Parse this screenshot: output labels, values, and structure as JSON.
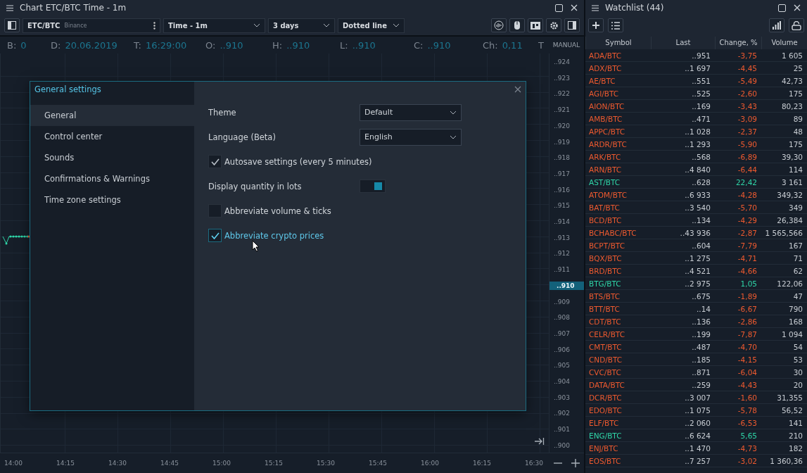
{
  "chart_panel": {
    "title": "Chart ETC/BTC Time - 1m",
    "toolbar": {
      "symbol": "ETC/BTC",
      "exchange": "Binance",
      "timeframe": "Time - 1m",
      "range": "3 days",
      "style": "Dotted line"
    },
    "info": [
      {
        "label": "B:",
        "value": "0"
      },
      {
        "label": "D:",
        "value": "20.06.2019"
      },
      {
        "label": "T:",
        "value": "16:29:00"
      },
      {
        "label": "O:",
        "value": "..910"
      },
      {
        "label": "H:",
        "value": "..910"
      },
      {
        "label": "L:",
        "value": "..910"
      },
      {
        "label": "C:",
        "value": "..910"
      },
      {
        "label": "Ch:",
        "value": "0,11"
      },
      {
        "label": "T"
      }
    ],
    "scale_mode": "MANUAL",
    "price_axis": [
      "..924",
      "..923",
      "..922",
      "..921",
      "..920",
      "..919",
      "..918",
      "..917",
      "..916",
      "..915",
      "..914",
      "..913",
      "..912",
      "..911",
      {
        "kind": "current",
        "label": "..910"
      },
      "..909",
      "..908",
      "..907",
      "..906",
      "..905",
      "..904",
      "..903",
      "..902",
      "..901",
      "..900"
    ],
    "time_axis": [
      "14:00",
      "14:15",
      "14:30",
      "14:45",
      "15:00",
      "15:15",
      "15:30",
      "15:45",
      "16:00",
      "16:15",
      "16:30"
    ]
  },
  "dialog": {
    "title": "General settings",
    "nav": [
      {
        "label": "General",
        "selected": true
      },
      {
        "label": "Control center",
        "selected": false
      },
      {
        "label": "Sounds",
        "selected": false
      },
      {
        "label": "Confirmations & Warnings",
        "selected": false
      },
      {
        "label": "Time zone settings",
        "selected": false
      }
    ],
    "settings": [
      {
        "kind": "select",
        "label": "Theme",
        "value": "Default"
      },
      {
        "kind": "select",
        "label": "Language (Beta)",
        "value": "English"
      },
      {
        "kind": "checkbox",
        "label": "Autosave settings (every 5 minutes)",
        "checked": true,
        "hovered": false
      },
      {
        "kind": "toggle",
        "label": "Display quantity in lots",
        "on": true
      },
      {
        "kind": "checkbox",
        "label": "Abbreviate volume & ticks",
        "checked": false,
        "hovered": false
      },
      {
        "kind": "checkbox",
        "label": "Abbreviate crypto prices",
        "checked": true,
        "hovered": true
      }
    ]
  },
  "watchlist": {
    "title": "Watchlist (44)",
    "columns": [
      "Symbol",
      "Last",
      "Change, %",
      "Volume"
    ],
    "rows": [
      {
        "symbol": "ADA/BTC",
        "last": "..951",
        "change": "-3,75",
        "volume": "1 605",
        "color": "#ef5a2f"
      },
      {
        "symbol": "ADX/BTC",
        "last": "..1 697",
        "change": "-4,45",
        "volume": "25",
        "color": "#ef5a2f"
      },
      {
        "symbol": "AE/BTC",
        "last": "..551",
        "change": "-5,49",
        "volume": "42,73",
        "color": "#ef5a2f"
      },
      {
        "symbol": "AGI/BTC",
        "last": "..525",
        "change": "-2,60",
        "volume": "175",
        "color": "#ef5a2f"
      },
      {
        "symbol": "AION/BTC",
        "last": "..169",
        "change": "-3,43",
        "volume": "80,23",
        "color": "#ef5a2f"
      },
      {
        "symbol": "AMB/BTC",
        "last": "..471",
        "change": "-3,09",
        "volume": "89",
        "color": "#ef5a2f"
      },
      {
        "symbol": "APPC/BTC",
        "last": "..1 028",
        "change": "-2,37",
        "volume": "48",
        "color": "#ef5a2f"
      },
      {
        "symbol": "ARDR/BTC",
        "last": "..1 293",
        "change": "-5,90",
        "volume": "175",
        "color": "#ef5a2f"
      },
      {
        "symbol": "ARK/BTC",
        "last": "..568",
        "change": "-6,89",
        "volume": "39,30",
        "color": "#ef5a2f"
      },
      {
        "symbol": "ARN/BTC",
        "last": "..4 840",
        "change": "-6,44",
        "volume": "114",
        "color": "#ef5a2f"
      },
      {
        "symbol": "AST/BTC",
        "last": "..628",
        "change": "22,42",
        "volume": "3 161",
        "color": "#2fd6a8"
      },
      {
        "symbol": "ATOM/BTC",
        "last": "..6 933",
        "change": "-4,28",
        "volume": "349,32",
        "color": "#ef5a2f"
      },
      {
        "symbol": "BAT/BTC",
        "last": "..3 540",
        "change": "-5,70",
        "volume": "349",
        "color": "#ef5a2f"
      },
      {
        "symbol": "BCD/BTC",
        "last": "..134",
        "change": "-4,29",
        "volume": "26,384",
        "color": "#ef5a2f"
      },
      {
        "symbol": "BCHABC/BTC",
        "last": "..43 936",
        "change": "-2,87",
        "volume": "1 565,566",
        "color": "#ef5a2f"
      },
      {
        "symbol": "BCPT/BTC",
        "last": "..604",
        "change": "-7,79",
        "volume": "167",
        "color": "#ef5a2f"
      },
      {
        "symbol": "BQX/BTC",
        "last": "..1 275",
        "change": "-4,71",
        "volume": "71",
        "color": "#ef5a2f"
      },
      {
        "symbol": "BRD/BTC",
        "last": "..4 521",
        "change": "-4,66",
        "volume": "62",
        "color": "#ef5a2f"
      },
      {
        "symbol": "BTG/BTC",
        "last": "..2 975",
        "change": "1,05",
        "volume": "122,06",
        "color": "#2fd6a8"
      },
      {
        "symbol": "BTS/BTC",
        "last": "..675",
        "change": "-1,89",
        "volume": "47",
        "color": "#ef5a2f"
      },
      {
        "symbol": "BTT/BTC",
        "last": "..14",
        "change": "-6,67",
        "volume": "790",
        "color": "#ef5a2f"
      },
      {
        "symbol": "CDT/BTC",
        "last": "..136",
        "change": "-2,86",
        "volume": "168",
        "color": "#ef5a2f"
      },
      {
        "symbol": "CELR/BTC",
        "last": "..199",
        "change": "-7,87",
        "volume": "1 094",
        "color": "#ef5a2f"
      },
      {
        "symbol": "CMT/BTC",
        "last": "..487",
        "change": "-4,70",
        "volume": "54",
        "color": "#ef5a2f"
      },
      {
        "symbol": "CND/BTC",
        "last": "..185",
        "change": "-4,15",
        "volume": "53",
        "color": "#ef5a2f"
      },
      {
        "symbol": "CVC/BTC",
        "last": "..871",
        "change": "-6,04",
        "volume": "30",
        "color": "#ef5a2f"
      },
      {
        "symbol": "DATA/BTC",
        "last": "..259",
        "change": "-4,43",
        "volume": "20",
        "color": "#ef5a2f"
      },
      {
        "symbol": "DCR/BTC",
        "last": "..3 007",
        "change": "-1,60",
        "volume": "31,355",
        "color": "#ef5a2f"
      },
      {
        "symbol": "EDO/BTC",
        "last": "..1 075",
        "change": "-5,78",
        "volume": "56,52",
        "color": "#ef5a2f"
      },
      {
        "symbol": "ELF/BTC",
        "last": "..2 060",
        "change": "-6,53",
        "volume": "141",
        "color": "#ef5a2f"
      },
      {
        "symbol": "ENG/BTC",
        "last": "..6 624",
        "change": "5,65",
        "volume": "210",
        "color": "#2fd6a8"
      },
      {
        "symbol": "ENJ/BTC",
        "last": "..1 470",
        "change": "-4,73",
        "volume": "182",
        "color": "#ef5a2f"
      },
      {
        "symbol": "EOS/BTC",
        "last": "..7 257",
        "change": "-3,02",
        "volume": "1 360,36",
        "color": "#ef5a2f"
      }
    ]
  }
}
